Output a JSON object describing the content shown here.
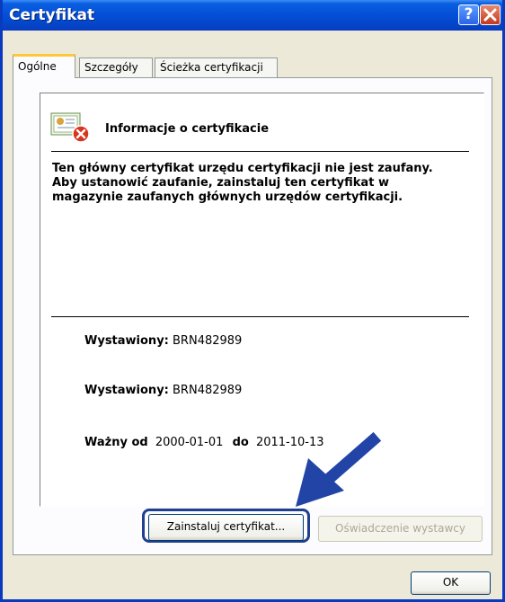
{
  "window": {
    "title": "Certyfikat"
  },
  "tabs": [
    "Ogólne",
    "Szczegóły",
    "Ścieżka certyfikacji"
  ],
  "cert": {
    "header": "Informacje o certyfikacie",
    "description": "Ten główny certyfikat urzędu certyfikacji nie jest zaufany. Aby ustanowić zaufanie, zainstaluj ten certyfikat w magazynie zaufanych głównych urzędów certyfikacji.",
    "issued_to_label": "Wystawiony",
    "issued_to_value": "BRN482989",
    "issued_by_label": "Wystawiony",
    "issued_by_value": "BRN482989",
    "valid_from_label": "Ważny od",
    "valid_from": "2000-01-01",
    "valid_to_label": "do",
    "valid_to": "2011-10-13"
  },
  "buttons": {
    "install": "Zainstaluj certyfikat...",
    "issuer_statement": "Oświadczenie wystawcy",
    "ok": "OK"
  },
  "colors": {
    "titlebar": "#0550D8",
    "accent_arrow": "#2144A6"
  },
  "icons": [
    "help-icon",
    "close-icon",
    "certificate-error-icon",
    "pointer-arrow-icon"
  ]
}
